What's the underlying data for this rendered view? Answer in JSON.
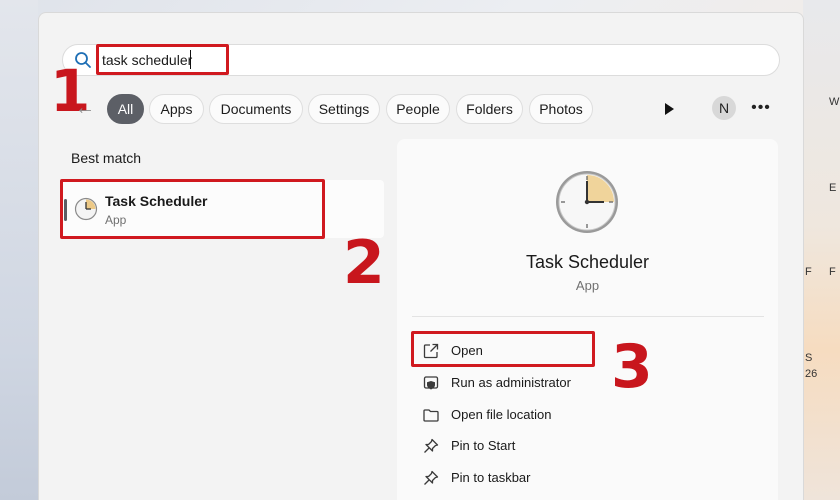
{
  "desktop": {
    "right_labels": [
      "W",
      "E",
      "F",
      "F",
      "S",
      "26"
    ]
  },
  "search": {
    "value": "task scheduler"
  },
  "filters": {
    "chips": [
      "All",
      "Apps",
      "Documents",
      "Settings",
      "People",
      "Folders",
      "Photos"
    ],
    "active": "All",
    "avatar_initial": "N"
  },
  "steps": [
    "1",
    "2",
    "3"
  ],
  "best_match": {
    "heading": "Best match",
    "title": "Task Scheduler",
    "subtitle": "App"
  },
  "details": {
    "title": "Task Scheduler",
    "subtitle": "App",
    "actions": [
      {
        "label": "Open",
        "icon": "open-external-icon"
      },
      {
        "label": "Run as administrator",
        "icon": "shield-admin-icon"
      },
      {
        "label": "Open file location",
        "icon": "folder-icon"
      },
      {
        "label": "Pin to Start",
        "icon": "pin-icon"
      },
      {
        "label": "Pin to taskbar",
        "icon": "pin-icon"
      }
    ]
  },
  "colors": {
    "highlight": "#d0191f",
    "step_number": "#c8161d",
    "active_chip": "#5c5f66"
  }
}
